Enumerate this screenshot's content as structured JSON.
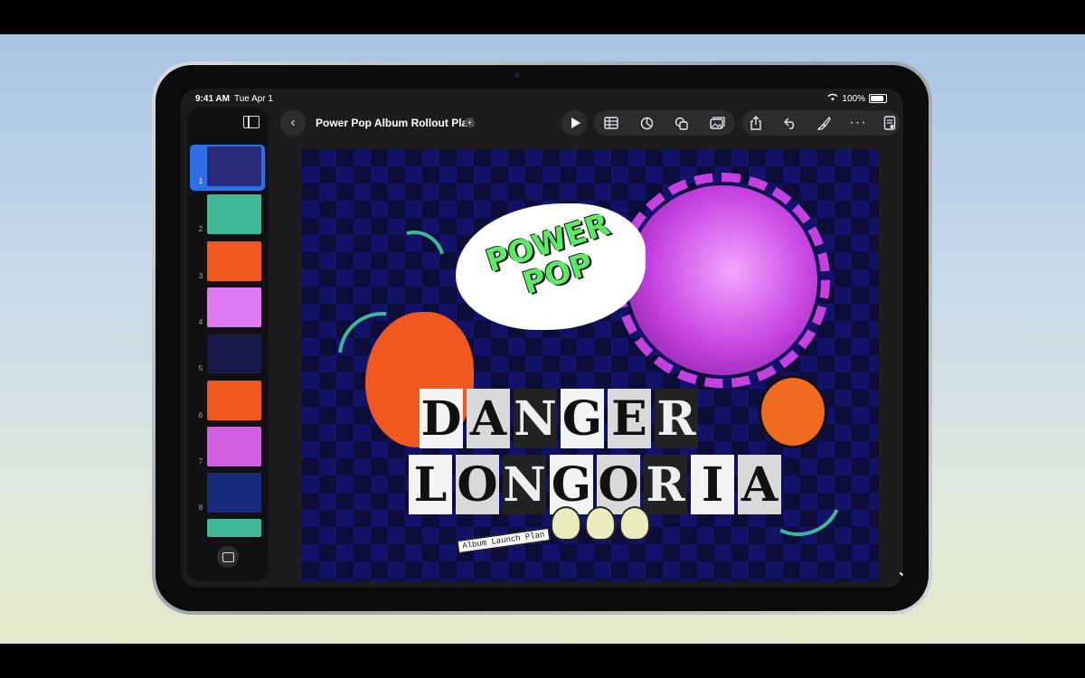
{
  "status": {
    "time": "9:41 AM",
    "date": "Tue Apr 1",
    "battery": "100%"
  },
  "document": {
    "title": "Power Pop Album Rollout Plan"
  },
  "toolbar": {
    "tools": [
      "play",
      "table",
      "chart",
      "shapes",
      "media",
      "share",
      "undo",
      "format",
      "more",
      "presenter"
    ]
  },
  "slides": [
    {
      "number": "1",
      "bg": "#2a2a7a",
      "caption": ""
    },
    {
      "number": "2",
      "bg": "#3fb89a",
      "caption": ""
    },
    {
      "number": "3",
      "bg": "#f0581f",
      "caption": ""
    },
    {
      "number": "4",
      "bg": "#e07af0",
      "caption": ""
    },
    {
      "number": "5",
      "bg": "#1a1a4a",
      "caption": ""
    },
    {
      "number": "6",
      "bg": "#f0581f",
      "caption": ""
    },
    {
      "number": "7",
      "bg": "#d060e0",
      "caption": ""
    },
    {
      "number": "8",
      "bg": "#1a2a7a",
      "caption": ""
    }
  ],
  "selected_slide": "1",
  "canvas": {
    "splash_text": "POWER POP",
    "title_line1": [
      "D",
      "A",
      "N",
      "G",
      "E",
      "R"
    ],
    "title_line2": [
      "L",
      "O",
      "N",
      "G",
      "O",
      "R",
      "I",
      "A"
    ],
    "caption": "Album Launch Plan"
  }
}
